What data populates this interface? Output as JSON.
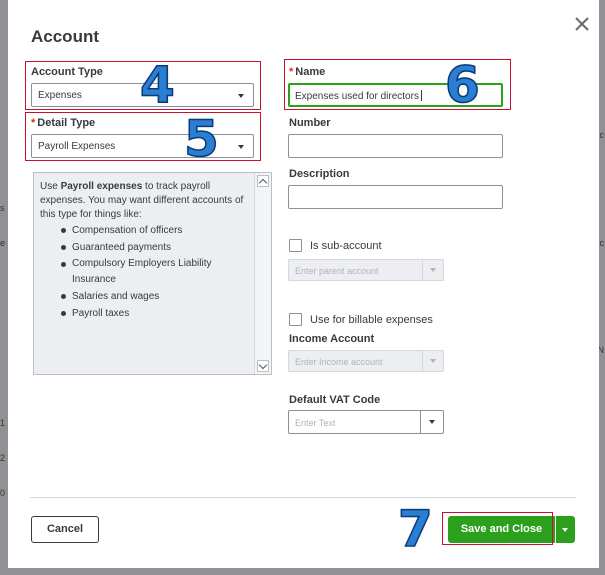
{
  "dialog": {
    "title": "Account"
  },
  "account_type": {
    "label": "Account Type",
    "value": "Expenses"
  },
  "detail_type": {
    "required_mark": "*",
    "label": "Detail Type",
    "value": "Payroll Expenses"
  },
  "description_help": {
    "intro_before": "Use ",
    "intro_bold": "Payroll expenses",
    "intro_after": " to track payroll expenses. You may want different accounts of this type for things like:",
    "items": [
      "Compensation of officers",
      "Guaranteed payments",
      "Compulsory Employers Liability Insurance",
      "Salaries and wages",
      "Payroll taxes"
    ]
  },
  "name": {
    "required_mark": "*",
    "label": "Name",
    "value": "Expenses used for directors"
  },
  "number": {
    "label": "Number",
    "value": ""
  },
  "description": {
    "label": "Description",
    "value": ""
  },
  "sub_account": {
    "label": "Is sub-account",
    "checked": false,
    "parent_placeholder": "Enter parent account"
  },
  "billable": {
    "label": "Use for billable expenses",
    "checked": false
  },
  "income_account": {
    "label": "Income Account",
    "placeholder": "Enter Income account"
  },
  "vat_code": {
    "label": "Default VAT Code",
    "placeholder": "Enter Text"
  },
  "footer": {
    "cancel_label": "Cancel",
    "save_label": "Save and Close"
  },
  "annotations": {
    "step_4": "4",
    "step_5": "5",
    "step_6": "6",
    "step_7": "7"
  },
  "colors": {
    "primary_green": "#2ca01c",
    "annotation_red": "#c8102e",
    "annotation_blue": "#2a7fd4"
  }
}
